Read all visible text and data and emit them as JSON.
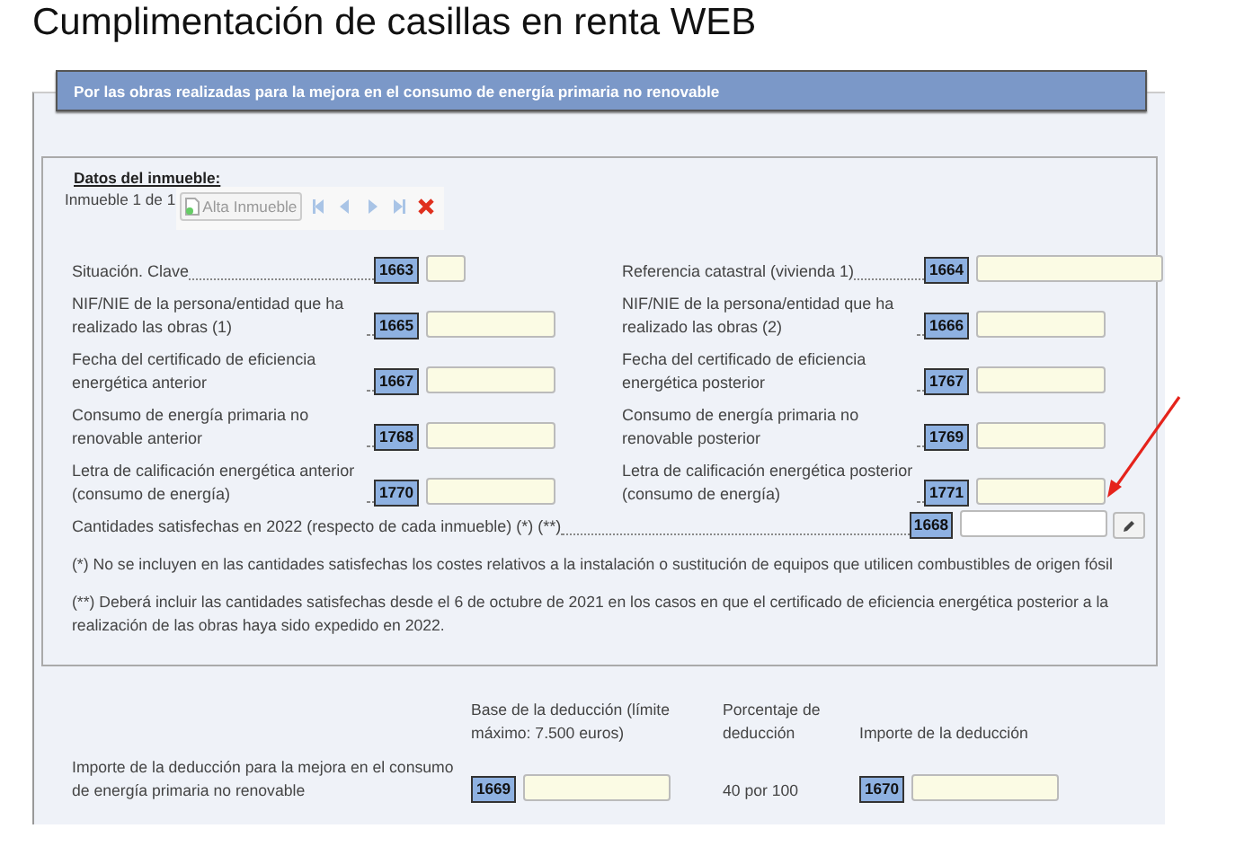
{
  "title": "Cumplimentación de casillas en renta WEB",
  "section": {
    "header": "Por las obras realizadas para la mejora en el consumo de energía primaria no renovable",
    "property_box": {
      "heading": "Datos del inmueble:",
      "counter": "Inmueble 1 de 1",
      "add_button": {
        "label": "Alta Inmueble",
        "disabled": true
      },
      "nav": [
        {
          "kind": "first",
          "disabled": true
        },
        {
          "kind": "prev",
          "disabled": true
        },
        {
          "kind": "next",
          "disabled": true
        },
        {
          "kind": "last",
          "disabled": true
        },
        {
          "kind": "delete",
          "disabled": false
        }
      ],
      "fields": [
        {
          "label": "Situación. Clave",
          "code": "1663",
          "kind": "key"
        },
        {
          "label": "Referencia catastral (vivienda 1)",
          "code": "1664",
          "kind": "reference"
        },
        {
          "label": "NIF/NIE de la persona/entidad que ha realizado las obras (1)",
          "code": "1665",
          "kind": "text"
        },
        {
          "label": "NIF/NIE de la persona/entidad que ha realizado las obras (2)",
          "code": "1666",
          "kind": "text"
        },
        {
          "label": "Fecha del certificado de eficiencia energética anterior",
          "code": "1667",
          "kind": "text"
        },
        {
          "label": "Fecha del certificado de eficiencia energética posterior",
          "code": "1767",
          "kind": "text"
        },
        {
          "label": "Consumo de energía primaria no renovable anterior",
          "code": "1768",
          "kind": "text"
        },
        {
          "label": "Consumo de energía primaria no renovable posterior",
          "code": "1769",
          "kind": "text"
        },
        {
          "label": "Letra de calificación energética anterior (consumo de energía)",
          "code": "1770",
          "kind": "text"
        },
        {
          "label": "Letra de calificación energética posterior (consumo de energía)",
          "code": "1771",
          "kind": "text"
        }
      ],
      "amount": {
        "label": "Cantidades satisfechas en 2022 (respecto de cada inmueble) (*) (**)",
        "code": "1668"
      },
      "notes": [
        "(*) No se incluyen en las cantidades satisfechas los costes relativos a la instalación o sustitución de equipos que utilicen combustibles de origen fósil",
        "(**) Deberá incluir las cantidades satisfechas desde el 6 de octubre de 2021 en los casos en que el certificado de eficiencia energética posterior a la realización de las obras haya sido expedido en 2022."
      ]
    },
    "deduction": {
      "columns": [
        "Base de la deducción (límite máximo: 7.500 euros)",
        "Porcentaje de deducción",
        "Importe de la deducción"
      ],
      "label": "Importe de la deducción para la mejora en el consumo de energía primaria no renovable",
      "base_code": "1669",
      "percentage": "40 por 100",
      "amount_code": "1670"
    }
  }
}
